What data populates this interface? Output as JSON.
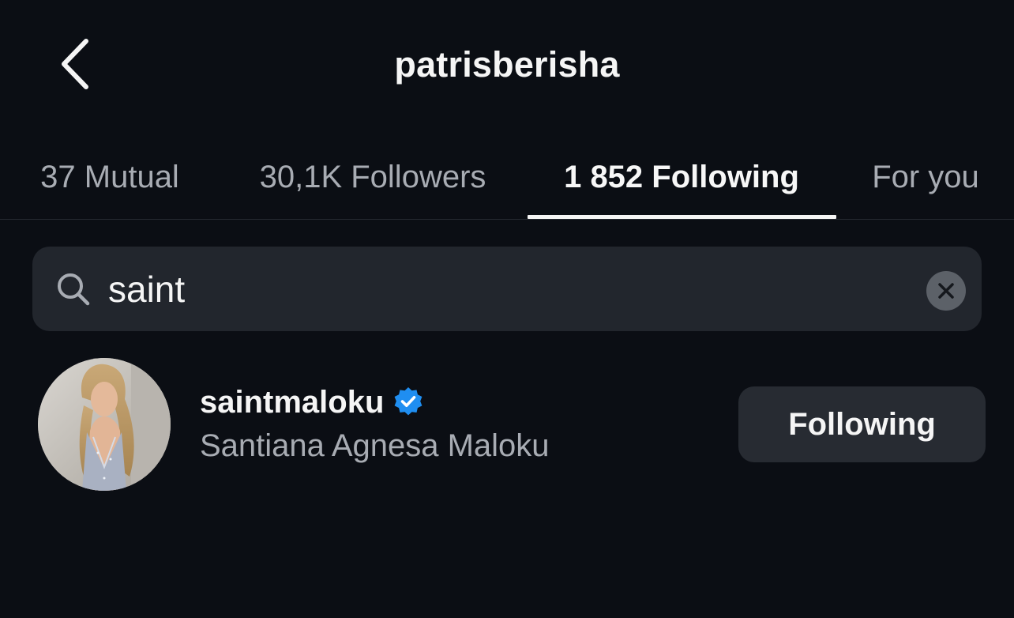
{
  "header": {
    "title": "patrisberisha",
    "back_icon": "chevron-left-icon"
  },
  "tabs": [
    {
      "label": "37 Mutual",
      "active": false
    },
    {
      "label": "30,1K Followers",
      "active": false
    },
    {
      "label": "1 852 Following",
      "active": true
    },
    {
      "label": "For you",
      "active": false
    }
  ],
  "search": {
    "value": "saint",
    "icon": "search-icon",
    "clear_icon": "close-icon"
  },
  "results": [
    {
      "username": "saintmaloku",
      "full_name": "Santiana Agnesa Maloku",
      "verified": true,
      "button_label": "Following"
    }
  ],
  "colors": {
    "background": "#0b0e14",
    "search_background": "#22262d",
    "verified_badge": "#1f8ef1",
    "button_background": "#272b32",
    "muted_text": "#a8acb3"
  }
}
